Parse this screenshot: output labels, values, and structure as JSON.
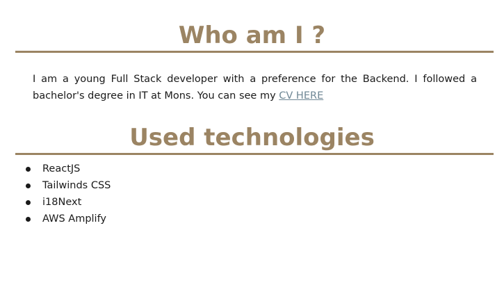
{
  "about": {
    "title": "Who am I ?",
    "text": "I am a young Full Stack developer with a preference for the Backend. I followed a bachelor's degree in IT at Mons. You can see my",
    "cv_link_label": "CV HERE"
  },
  "technologies": {
    "title": "Used technologies",
    "items": [
      "ReactJS",
      "Tailwinds CSS",
      "i18Next",
      "AWS Amplify"
    ]
  },
  "colors": {
    "accent": "#9b8463",
    "link": "#6f8795",
    "text": "#1a1a1a"
  }
}
